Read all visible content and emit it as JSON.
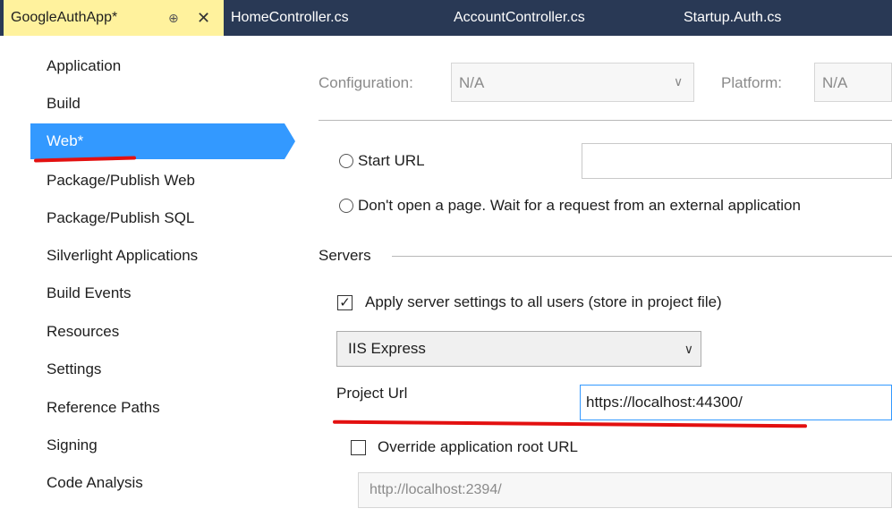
{
  "tabs": [
    {
      "label": "GoogleAuthApp*",
      "pin_glyph": "⊕",
      "close_glyph": "✕"
    },
    {
      "label": "HomeController.cs"
    },
    {
      "label": "AccountController.cs"
    },
    {
      "label": "Startup.Auth.cs"
    }
  ],
  "nav": {
    "items": [
      {
        "label": "Application"
      },
      {
        "label": "Build"
      },
      {
        "label": "Web*"
      },
      {
        "label": "Package/Publish Web"
      },
      {
        "label": "Package/Publish SQL"
      },
      {
        "label": "Silverlight Applications"
      },
      {
        "label": "Build Events"
      },
      {
        "label": "Resources"
      },
      {
        "label": "Settings"
      },
      {
        "label": "Reference Paths"
      },
      {
        "label": "Signing"
      },
      {
        "label": "Code Analysis"
      }
    ],
    "selected_index": 2
  },
  "config": {
    "configuration_label": "Configuration:",
    "configuration_value": "N/A",
    "platform_label": "Platform:",
    "platform_value": "N/A"
  },
  "start_action": {
    "start_url_label": "Start URL",
    "start_url_value": "",
    "dont_open_label": "Don't open a page.  Wait for a request from an external application"
  },
  "servers": {
    "section_label": "Servers",
    "apply_checkbox_label": "Apply server settings to all users (store in project file)",
    "apply_checked": true,
    "check_glyph": "✓",
    "server_type": "IIS Express",
    "project_url_label": "Project Url",
    "project_url_value": "https://localhost:44300/",
    "override_label": "Override application root URL",
    "override_checked": false,
    "override_url_value": "http://localhost:2394/"
  },
  "icons": {
    "chevron": "∨",
    "combo_chevron": "⌄"
  },
  "colors": {
    "tab_strip": "#293955",
    "active_tab": "#fff29d",
    "nav_selected": "#3399ff",
    "annotation_red": "#e31010"
  }
}
